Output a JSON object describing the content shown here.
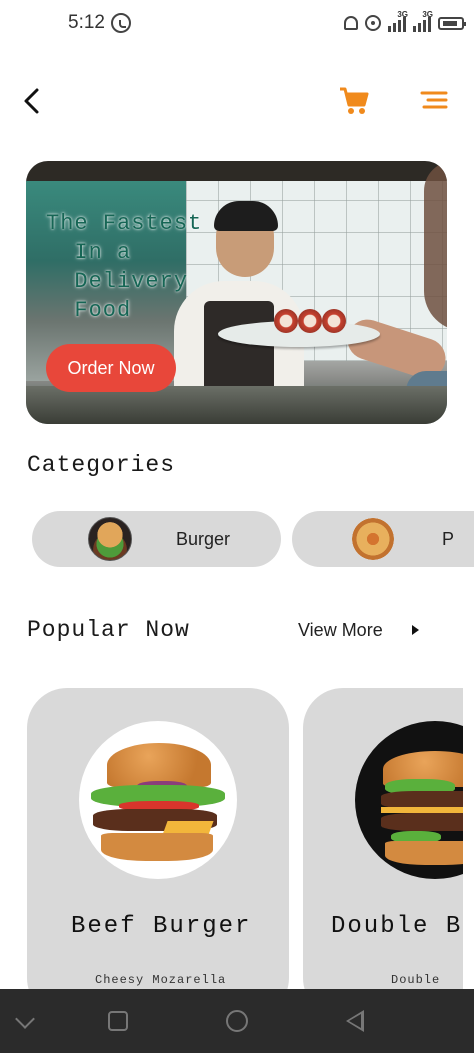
{
  "status_bar": {
    "time": "5:12",
    "network_1": "3G",
    "network_2": "3G"
  },
  "header": {
    "back_icon": "chevron-left-icon",
    "cart_icon": "cart-icon",
    "menu_icon": "menu-icon",
    "accent_color": "#f08a1c"
  },
  "hero": {
    "title_lines": [
      "The Fastest",
      "  In a",
      "  Delivery",
      "  Food"
    ],
    "button_label": "Order Now",
    "button_color": "#e8473a"
  },
  "categories": {
    "title": "Categories",
    "items": [
      {
        "label": "Burger",
        "icon": "burger-icon"
      },
      {
        "label": "P",
        "icon": "pizza-icon"
      }
    ]
  },
  "popular": {
    "title": "Popular Now",
    "view_more": "View More",
    "items": [
      {
        "name": "Beef Burger",
        "subtitle": "Cheesy Mozarella"
      },
      {
        "name": "Double B",
        "subtitle": "Double"
      }
    ]
  },
  "nav_bar": {
    "icons": [
      "chevron-down-icon",
      "recents-icon",
      "home-icon",
      "back-icon"
    ]
  }
}
